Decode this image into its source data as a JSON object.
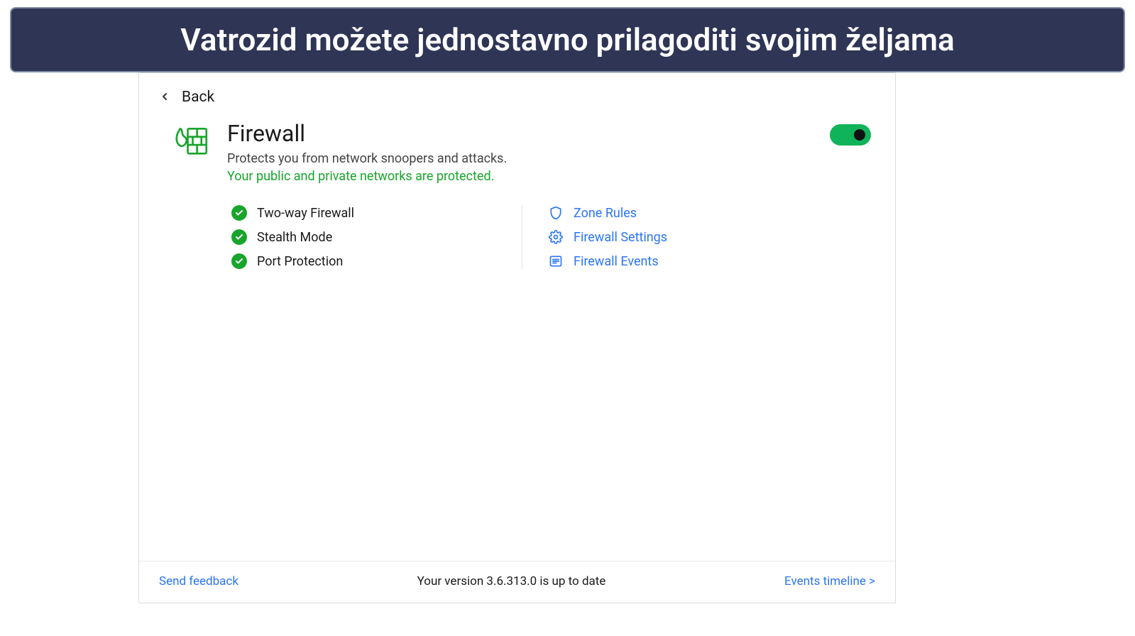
{
  "banner": {
    "text": "Vatrozid možete jednostavno prilagoditi svojim željama"
  },
  "back": {
    "label": "Back"
  },
  "header": {
    "title": "Firewall",
    "subtitle": "Protects you from network snoopers and attacks.",
    "status": "Your public and private networks are protected."
  },
  "toggle": {
    "enabled": true
  },
  "features": [
    {
      "label": "Two-way Firewall"
    },
    {
      "label": "Stealth Mode"
    },
    {
      "label": "Port Protection"
    }
  ],
  "links": [
    {
      "icon": "shield-icon",
      "label": "Zone Rules"
    },
    {
      "icon": "gear-icon",
      "label": "Firewall Settings"
    },
    {
      "icon": "list-icon",
      "label": "Firewall Events"
    }
  ],
  "footer": {
    "feedback": "Send feedback",
    "version": "Your version 3.6.313.0 is up to date",
    "events": "Events timeline >"
  },
  "colors": {
    "banner_bg": "#2e3555",
    "accent_green": "#17a52b",
    "toggle_green": "#0fb35a",
    "link_blue": "#2a76f4"
  }
}
